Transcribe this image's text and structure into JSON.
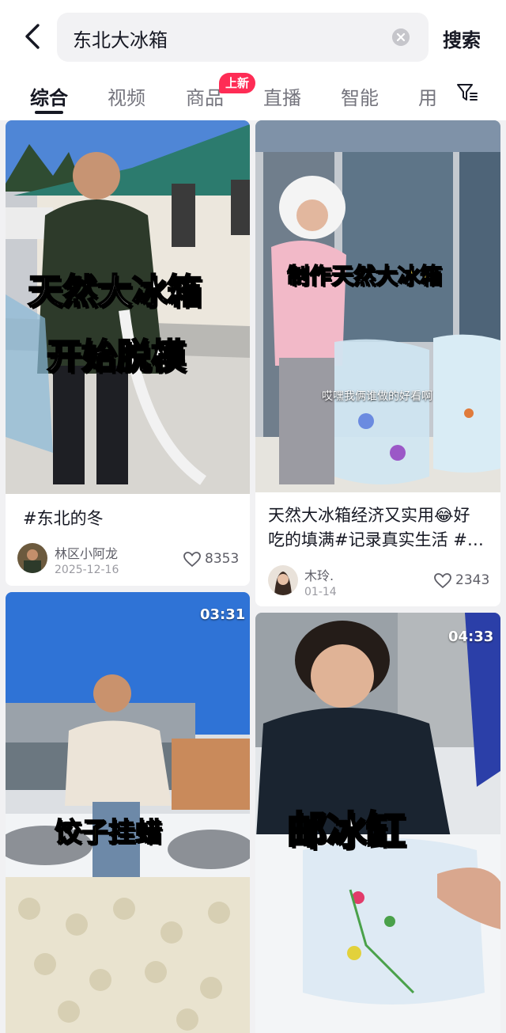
{
  "search": {
    "query": "东北大冰箱",
    "submit_label": "搜索"
  },
  "tabs": {
    "items": [
      "综合",
      "视频",
      "商品",
      "直播",
      "智能",
      "用"
    ],
    "active": "综合",
    "new_badge": "上新"
  },
  "results": [
    {
      "overlay_lines": [
        "天然大冰箱",
        "开始脱模"
      ],
      "caption": "#东北的冬",
      "author": "林区小阿龙",
      "date": "2025-12-16",
      "likes": "8353"
    },
    {
      "overlay_lines": [
        "制作天然大冰箱"
      ],
      "subtitle": "哎嘿我俩谁做的好看啊",
      "caption_line1": "天然大冰箱经济又实用😂好",
      "caption_line2": "吃的填满#记录真实生活 #…",
      "author": "木玲.",
      "date": "01-14",
      "likes": "2343"
    },
    {
      "duration": "03:31",
      "overlay_lines": [
        "饺子挂蜡"
      ]
    },
    {
      "duration": "04:33",
      "overlay_lines": [
        "邮冰缸"
      ]
    }
  ],
  "colors": {
    "accent": "#fe2c55",
    "overlay_white": "#ffffff",
    "overlay_yellow": "#ffe24a"
  },
  "icons": [
    "back-arrow-icon",
    "clear-icon",
    "filter-icon",
    "heart-icon"
  ]
}
